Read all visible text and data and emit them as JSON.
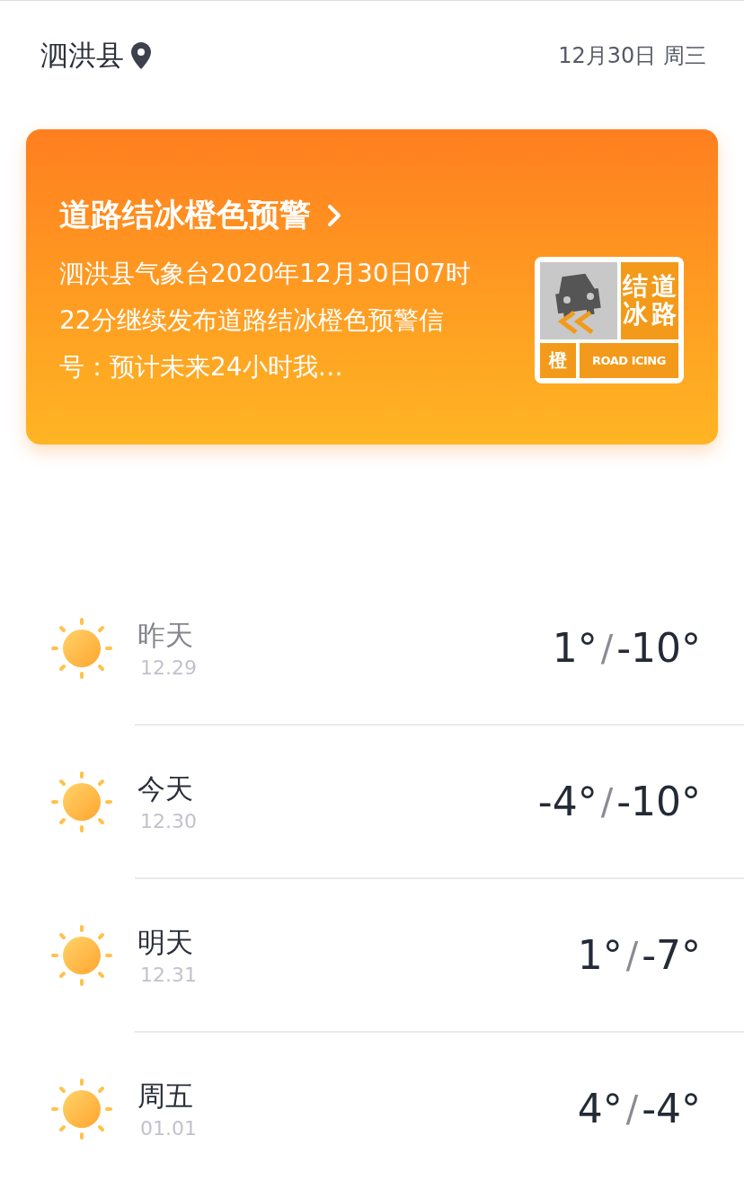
{
  "header": {
    "location": "泗洪县",
    "date": "12月30日 周三"
  },
  "alert": {
    "title": "道路结冰橙色预警",
    "text": "泗洪县气象台2020年12月30日07时22分继续发布道路结冰橙色预警信号：预计未来24小时我…",
    "badge": {
      "columns": [
        "结冰",
        "道路"
      ],
      "level_text": "橙",
      "english": "ROAD ICING"
    }
  },
  "days": [
    {
      "name": "昨天",
      "date": "12.29",
      "high": "1°",
      "separator": "/",
      "low": "-10°",
      "past": true
    },
    {
      "name": "今天",
      "date": "12.30",
      "high": "-4°",
      "separator": "/",
      "low": "-10°",
      "past": false
    },
    {
      "name": "明天",
      "date": "12.31",
      "high": "1°",
      "separator": "/",
      "low": "-7°",
      "past": false
    },
    {
      "name": "周五",
      "date": "01.01",
      "high": "4°",
      "separator": "/",
      "low": "-4°",
      "past": false
    }
  ]
}
